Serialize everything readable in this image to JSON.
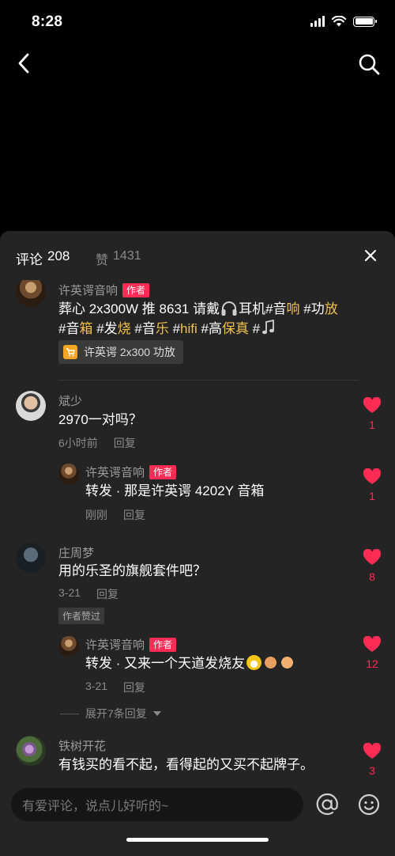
{
  "status_bar": {
    "time": "8:28"
  },
  "sheet": {
    "tabs": {
      "comments_label": "评论",
      "comments_count": "208",
      "likes_label": "赞",
      "likes_count": "1431"
    }
  },
  "comments": [
    {
      "user": "许英谔音响",
      "badge": "作者",
      "text_parts": [
        "葬心 2x300W 推 8631 请戴",
        "耳机#音",
        "响",
        " #功",
        "放",
        " #音",
        "箱",
        " #发",
        "烧",
        " #音",
        "乐",
        " #",
        "hifi",
        " #高",
        "保真",
        " #"
      ],
      "product": "许英谔 2x300 功放"
    },
    {
      "user": "斌少",
      "text": "2970一对吗？",
      "time": "6小时前",
      "reply_label": "回复",
      "likes": "1",
      "replies": [
        {
          "user": "许英谔音响",
          "badge": "作者",
          "text": "转发 · 那是许英谔 4202Y 音箱",
          "time": "刚刚",
          "reply_label": "回复",
          "likes": "1"
        }
      ]
    },
    {
      "user": "庄周梦",
      "text": "用的乐圣的旗舰套件吧？",
      "time": "3-21",
      "reply_label": "回复",
      "likes": "8",
      "tag": "作者赞过",
      "replies": [
        {
          "user": "许英谔音响",
          "badge": "作者",
          "text": "转发 · 又来一个天道发烧友",
          "time": "3-21",
          "reply_label": "回复",
          "likes": "12"
        }
      ],
      "expand_label": "展开7条回复"
    },
    {
      "user": "铁树开花",
      "text": "有钱买的看不起，看得起的又买不起牌子。",
      "likes": "3"
    }
  ],
  "input": {
    "placeholder": "有爱评论，说点儿好听的~"
  },
  "colors": {
    "accent": "#fe2c55",
    "highlight": "#f0c14b",
    "sheet_bg": "#242424"
  },
  "icons": [
    "back-icon",
    "search-icon",
    "close-icon",
    "heart-icon",
    "headphones-icon",
    "music-note-icon",
    "cart-icon",
    "at-icon",
    "emoji-icon"
  ]
}
